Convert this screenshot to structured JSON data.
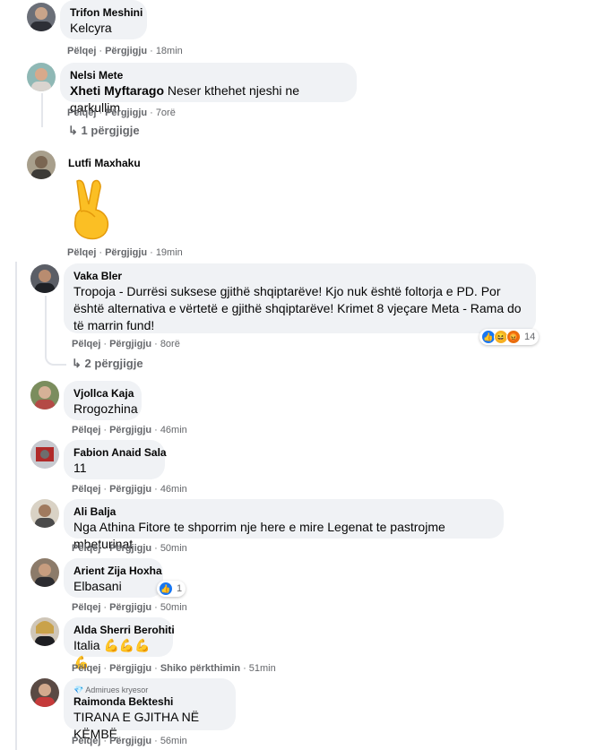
{
  "labels": {
    "like": "Pëlqej",
    "reply": "Përgjigju",
    "see_translation": "Shiko përkthimin"
  },
  "comments": [
    {
      "name": "Trifon Meshini",
      "text": "Kelcyra",
      "time": "18min"
    },
    {
      "name": "Nelsi Mete",
      "tag": "Xheti Myftarago",
      "text": "Neser kthehet njeshi ne qarkullim",
      "time": "7orë",
      "replies": "1 përgjigje"
    },
    {
      "name": "Lutfi Maxhaku",
      "text": "✌️",
      "time": "19min"
    },
    {
      "name": "Vaka Bler",
      "text": "Tropoja - Durrësi suksese gjithë shqiptarëve! Kjo nuk është foltorja e PD. Por është alternativa e vërtetë e gjithë shqiptarëve! Krimet 8 vjeçare Meta - Rama do të marrin fund!",
      "time": "8orë",
      "reactions": "14",
      "replies": "2 përgjigje"
    },
    {
      "name": "Vjollca Kaja",
      "text": "Rrogozhina",
      "time": "46min"
    },
    {
      "name": "Fabion Anaid Sala",
      "text": "11",
      "time": "46min"
    },
    {
      "name": "Ali Balja",
      "text": "Nga Athina Fitore te shporrim nje here e mire Legenat te pastrojme mbeturinat",
      "time": "50min"
    },
    {
      "name": "Arient Zija Hoxha",
      "text": "Elbasani",
      "time": "50min",
      "reactions": "1"
    },
    {
      "name": "Alda Sherri Berohiti",
      "text": "Italia 💪💪💪💪",
      "time": "51min"
    },
    {
      "name": "Raimonda Bekteshi",
      "badge": "Admirues kryesor",
      "text": "TIRANA E GJITHA NË KËMBË",
      "time": "56min"
    }
  ],
  "colors": {
    "bubble": "#f0f2f5",
    "meta": "#65676b",
    "text": "#050505",
    "like_blue": "#1877f2"
  }
}
